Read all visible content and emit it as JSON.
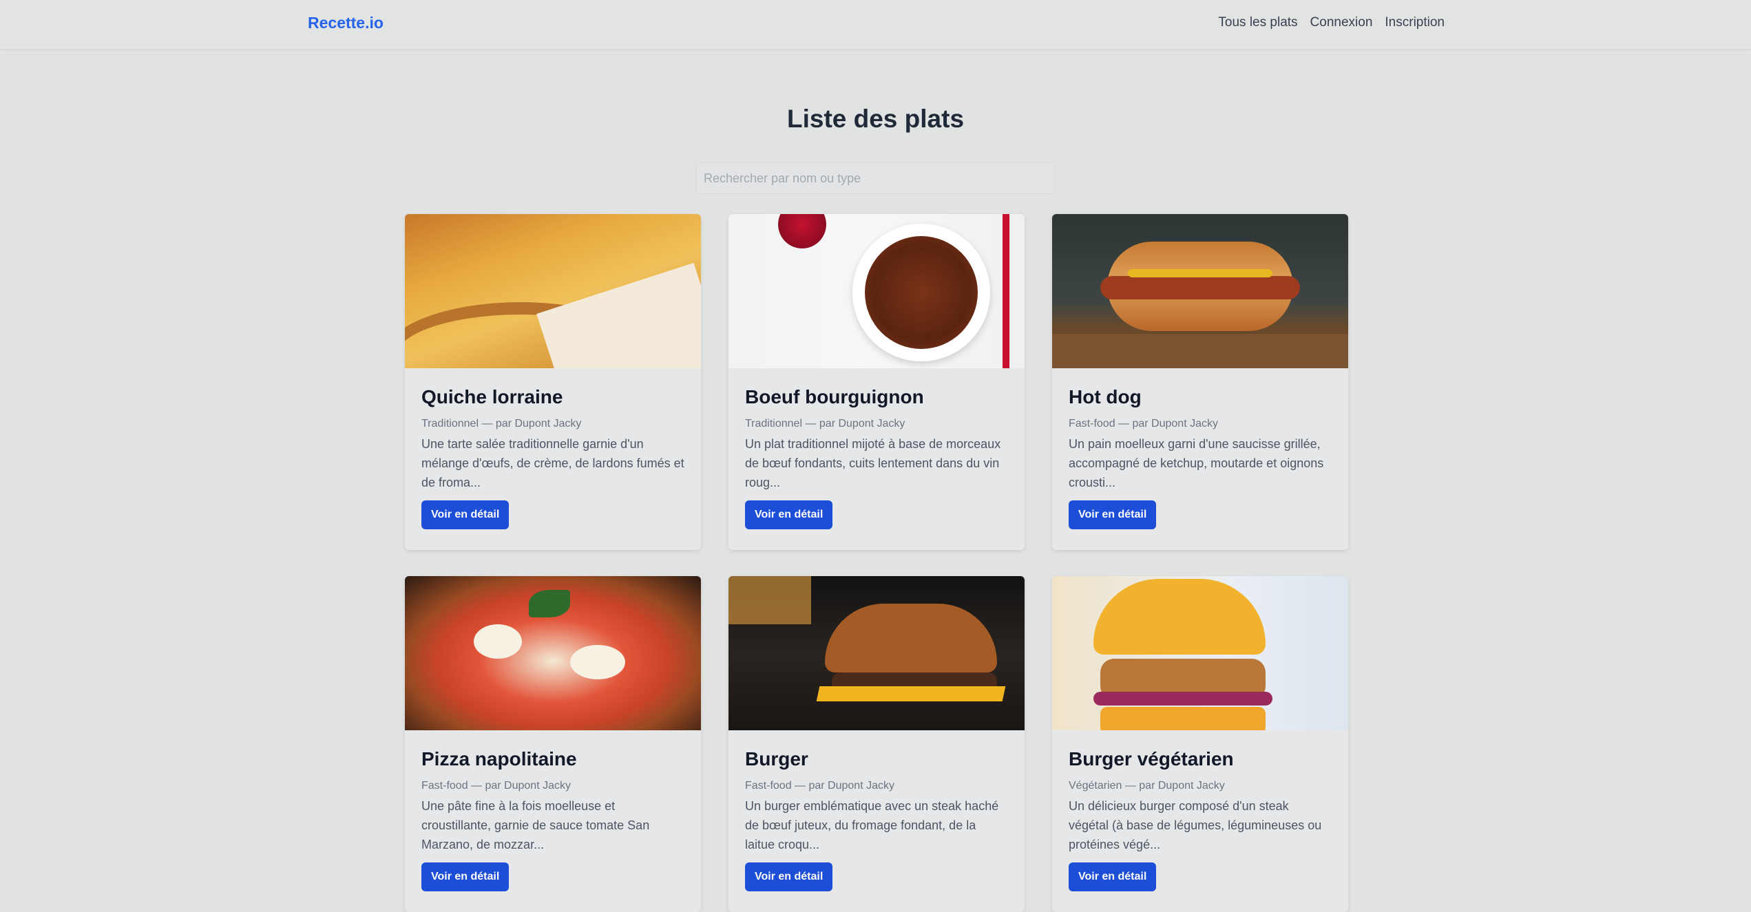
{
  "nav": {
    "brand": "Recette.io",
    "links": [
      "Tous les plats",
      "Connexion",
      "Inscription"
    ]
  },
  "page": {
    "title": "Liste des plats",
    "search_placeholder": "Rechercher par nom ou type"
  },
  "cards": [
    {
      "title": "Quiche lorraine",
      "meta": "Traditionnel — par Dupont Jacky",
      "description": "Une tarte salée traditionnelle garnie d'un mélange d'œufs, de crème, de lardons fumés et de froma...",
      "button": "Voir en détail"
    },
    {
      "title": "Boeuf bourguignon",
      "meta": "Traditionnel — par Dupont Jacky",
      "description": "Un plat traditionnel mijoté à base de morceaux de bœuf fondants, cuits lentement dans du vin roug...",
      "button": "Voir en détail"
    },
    {
      "title": "Hot dog",
      "meta": "Fast-food — par Dupont Jacky",
      "description": "Un pain moelleux garni d'une saucisse grillée, accompagné de ketchup, moutarde et oignons crousti...",
      "button": "Voir en détail"
    },
    {
      "title": "Pizza napolitaine",
      "meta": "Fast-food — par Dupont Jacky",
      "description": "Une pâte fine à la fois moelleuse et croustillante, garnie de sauce tomate San Marzano, de mozzar...",
      "button": "Voir en détail"
    },
    {
      "title": "Burger",
      "meta": "Fast-food — par Dupont Jacky",
      "description": "Un burger emblématique avec un steak haché de bœuf juteux, du fromage fondant, de la laitue croqu...",
      "button": "Voir en détail"
    },
    {
      "title": "Burger végétarien",
      "meta": "Végétarien — par Dupont Jacky",
      "description": "Un délicieux burger composé d'un steak végétal (à base de légumes, légumineuses ou protéines végé...",
      "button": "Voir en détail"
    }
  ]
}
